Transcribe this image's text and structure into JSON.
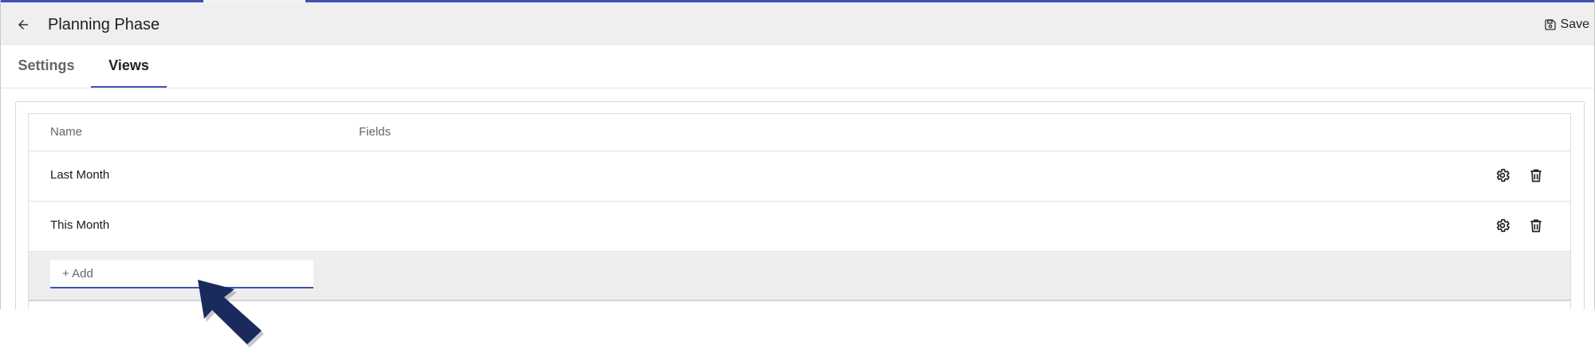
{
  "header": {
    "title": "Planning Phase",
    "back_icon": "arrow-left-icon",
    "save_label": "Save",
    "save_icon": "floppy-disk-icon"
  },
  "tabs": [
    {
      "label": "Settings",
      "active": false
    },
    {
      "label": "Views",
      "active": true
    }
  ],
  "views_table": {
    "columns": [
      "Name",
      "Fields"
    ],
    "rows": [
      {
        "name": "Last Month",
        "fields": "",
        "actions": [
          "gear-icon",
          "trash-icon"
        ]
      },
      {
        "name": "This Month",
        "fields": "",
        "actions": [
          "gear-icon",
          "trash-icon"
        ]
      }
    ],
    "add_placeholder": "+ Add"
  },
  "colors": {
    "accent": "#3f51b5",
    "header_bg": "#efefef",
    "annotation_arrow": "#1b2a5c"
  }
}
